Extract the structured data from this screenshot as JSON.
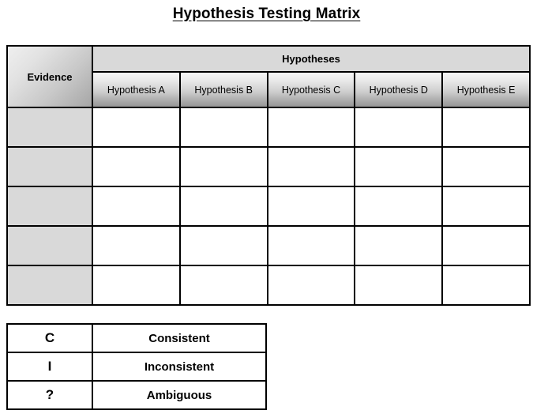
{
  "page": {
    "title": "Hypothesis Testing Matrix"
  },
  "matrix": {
    "evidence_header": "Evidence",
    "group_header": "Hypotheses",
    "column_headers": [
      "Hypothesis A",
      "Hypothesis B",
      "Hypothesis C",
      "Hypothesis D",
      "Hypothesis E"
    ],
    "rows": [
      {
        "evidence": "",
        "cells": [
          "",
          "",
          "",
          "",
          ""
        ]
      },
      {
        "evidence": "",
        "cells": [
          "",
          "",
          "",
          "",
          ""
        ]
      },
      {
        "evidence": "",
        "cells": [
          "",
          "",
          "",
          "",
          ""
        ]
      },
      {
        "evidence": "",
        "cells": [
          "",
          "",
          "",
          "",
          ""
        ]
      },
      {
        "evidence": "",
        "cells": [
          "",
          "",
          "",
          "",
          ""
        ]
      }
    ]
  },
  "legend": {
    "rows": [
      {
        "symbol": "C",
        "label": "Consistent"
      },
      {
        "symbol": "I",
        "label": "Inconsistent"
      },
      {
        "symbol": "?",
        "label": "Ambiguous"
      }
    ]
  },
  "colors": {
    "border": "#000000",
    "group_header_fill": "#d9d9d9",
    "evidence_cell_fill": "#d9d9d9",
    "data_cell_fill": "#ffffff",
    "page_background": "#ffffff",
    "text": "#000000"
  }
}
